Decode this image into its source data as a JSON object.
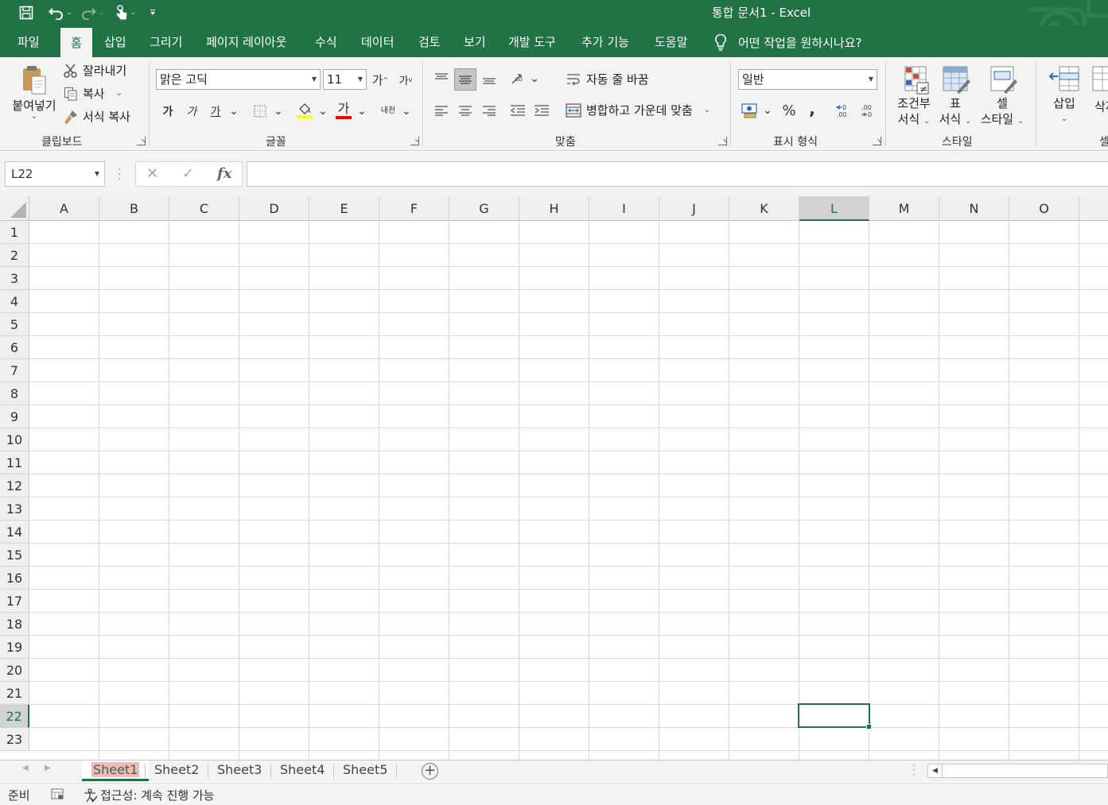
{
  "window": {
    "title": "통합 문서1  -  Excel",
    "accent": "#217346"
  },
  "menu": {
    "tabs": [
      "파일",
      "홈",
      "삽입",
      "그리기",
      "페이지 레이아웃",
      "수식",
      "데이터",
      "검토",
      "보기",
      "개발 도구",
      "추가 기능",
      "도움말"
    ],
    "active_tab": "홈",
    "tell_me": "어떤 작업을 원하시나요?"
  },
  "ribbon": {
    "clipboard": {
      "paste": "붙여넣기",
      "cut": "잘라내기",
      "copy": "복사",
      "format_painter": "서식 복사",
      "label": "클립보드"
    },
    "font": {
      "name": "맑은 고딕",
      "size": "11",
      "grow": "가",
      "shrink": "가",
      "bold": "가",
      "italic": "가",
      "underline": "가",
      "font_color_glyph": "가",
      "phonetic": "내천",
      "label": "글꼴",
      "fill_color": "#ffff00",
      "text_color": "#ff0000"
    },
    "alignment": {
      "wrap_text": "자동 줄 바꿈",
      "merge_center": "병합하고 가운데 맞춤",
      "label": "맞춤"
    },
    "number": {
      "format": "일반",
      "percent": "%",
      "comma": ",",
      "label": "표시 형식"
    },
    "styles": {
      "conditional_line1": "조건부",
      "conditional_line2": "서식",
      "table_line1": "표",
      "table_line2": "서식",
      "cell_line1": "셀",
      "cell_line2": "스타일",
      "label": "스타일"
    },
    "cells": {
      "insert": "삽입",
      "delete_partial": "삭제",
      "label": "셀"
    }
  },
  "formula_bar": {
    "name_box": "L22",
    "cancel": "✕",
    "enter": "✓",
    "fx": "fx",
    "value": ""
  },
  "grid": {
    "columns": [
      "A",
      "B",
      "C",
      "D",
      "E",
      "F",
      "G",
      "H",
      "I",
      "J",
      "K",
      "L",
      "M",
      "N",
      "O"
    ],
    "rows": [
      "1",
      "2",
      "3",
      "4",
      "5",
      "6",
      "7",
      "8",
      "9",
      "10",
      "11",
      "12",
      "13",
      "14",
      "15",
      "16",
      "17",
      "18",
      "19",
      "20",
      "21",
      "22",
      "23"
    ],
    "selected_column": "L",
    "selected_row": "22"
  },
  "sheets": {
    "tabs": [
      "Sheet1",
      "Sheet2",
      "Sheet3",
      "Sheet4",
      "Sheet5"
    ],
    "active": "Sheet1"
  },
  "status": {
    "mode": "준비",
    "accessibility": "접근성: 계속 진행 가능"
  }
}
